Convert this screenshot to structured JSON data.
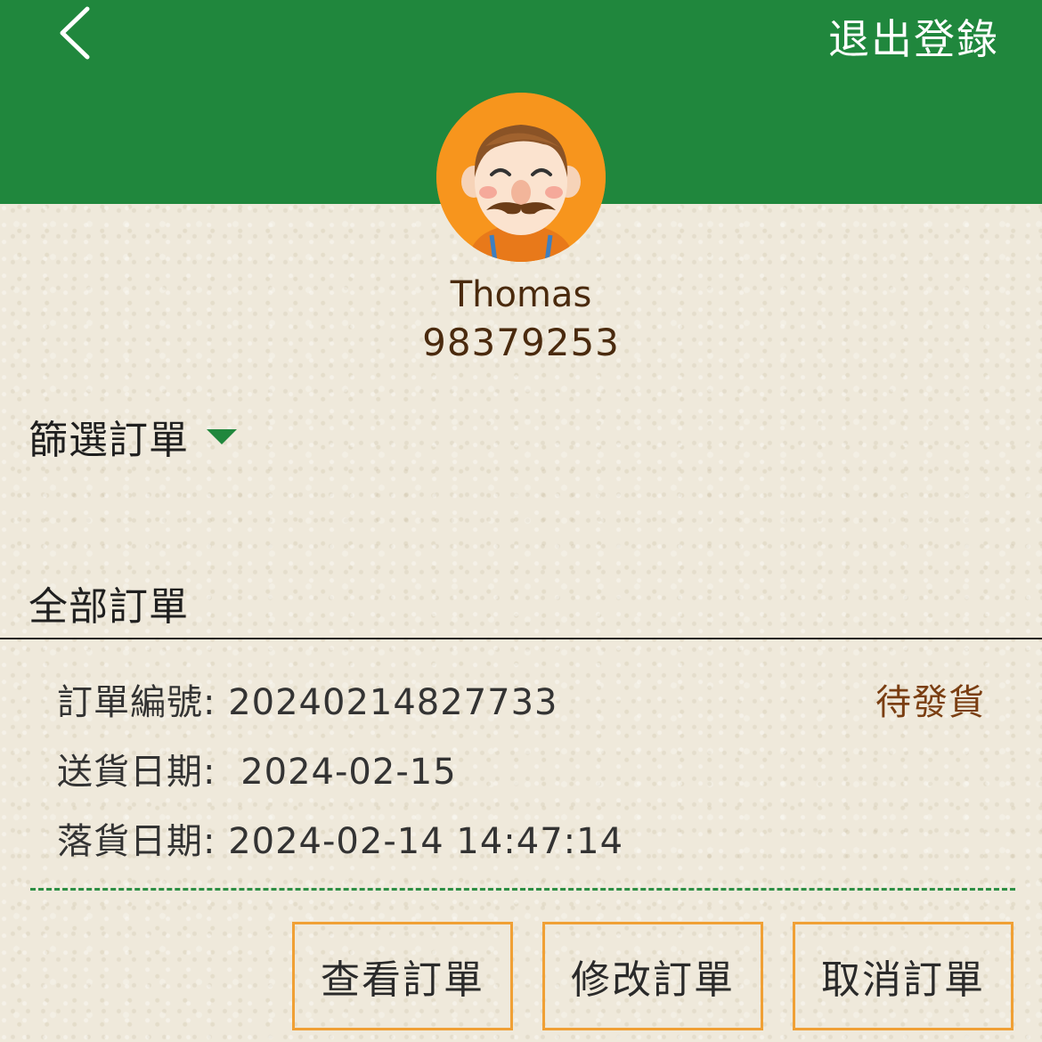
{
  "header": {
    "logout_label": "退出登錄",
    "bg_color": "#20873d"
  },
  "user": {
    "name": "Thomas",
    "phone": "98379253"
  },
  "filter": {
    "label": "篩選訂單"
  },
  "section": {
    "title": "全部訂單"
  },
  "order": {
    "number_label": "訂單編號:",
    "number": "20240214827733",
    "status": "待發貨",
    "delivery_label": "送貨日期:",
    "delivery_date": "2024-02-15",
    "placed_label": "落貨日期:",
    "placed_datetime": "2024-02-14 14:47:14"
  },
  "actions": {
    "view_label": "查看訂單",
    "edit_label": "修改訂單",
    "cancel_label": "取消訂單",
    "border_color": "#f0a035"
  },
  "icons": {
    "back": "chevron-left-icon",
    "avatar": "user-avatar",
    "filter_caret": "caret-down-icon"
  }
}
